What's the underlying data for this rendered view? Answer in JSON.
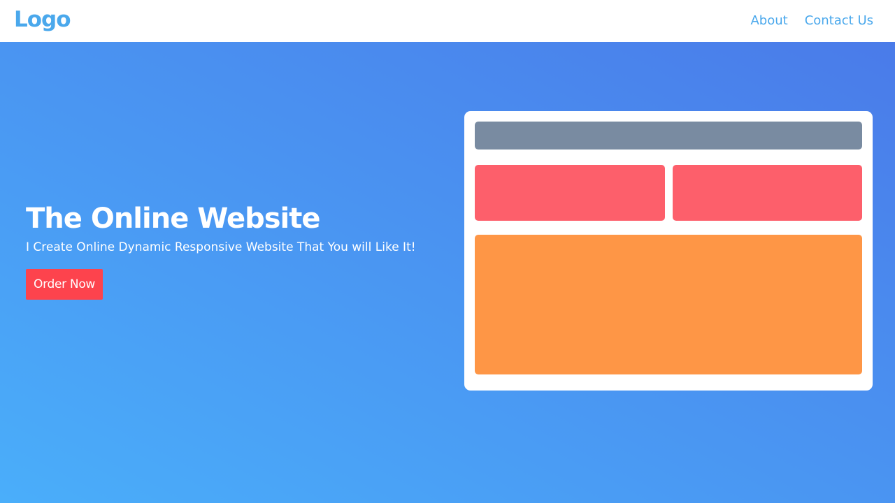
{
  "nav": {
    "logo": "Logo",
    "links": [
      "About",
      "Contact Us"
    ]
  },
  "hero": {
    "title": "The Online Website",
    "subtitle": "I Create Online Dynamic Responsive Website That You will Like It!",
    "cta_label": "Order Now"
  },
  "colors": {
    "brand": "#4aa8ec",
    "gradient_start": "#4aaefa",
    "gradient_end": "#4a7be9",
    "cta": "#fd434d",
    "mock_bar": "#798ba1",
    "mock_tile": "#fd5f6b",
    "mock_panel": "#fe9646"
  }
}
